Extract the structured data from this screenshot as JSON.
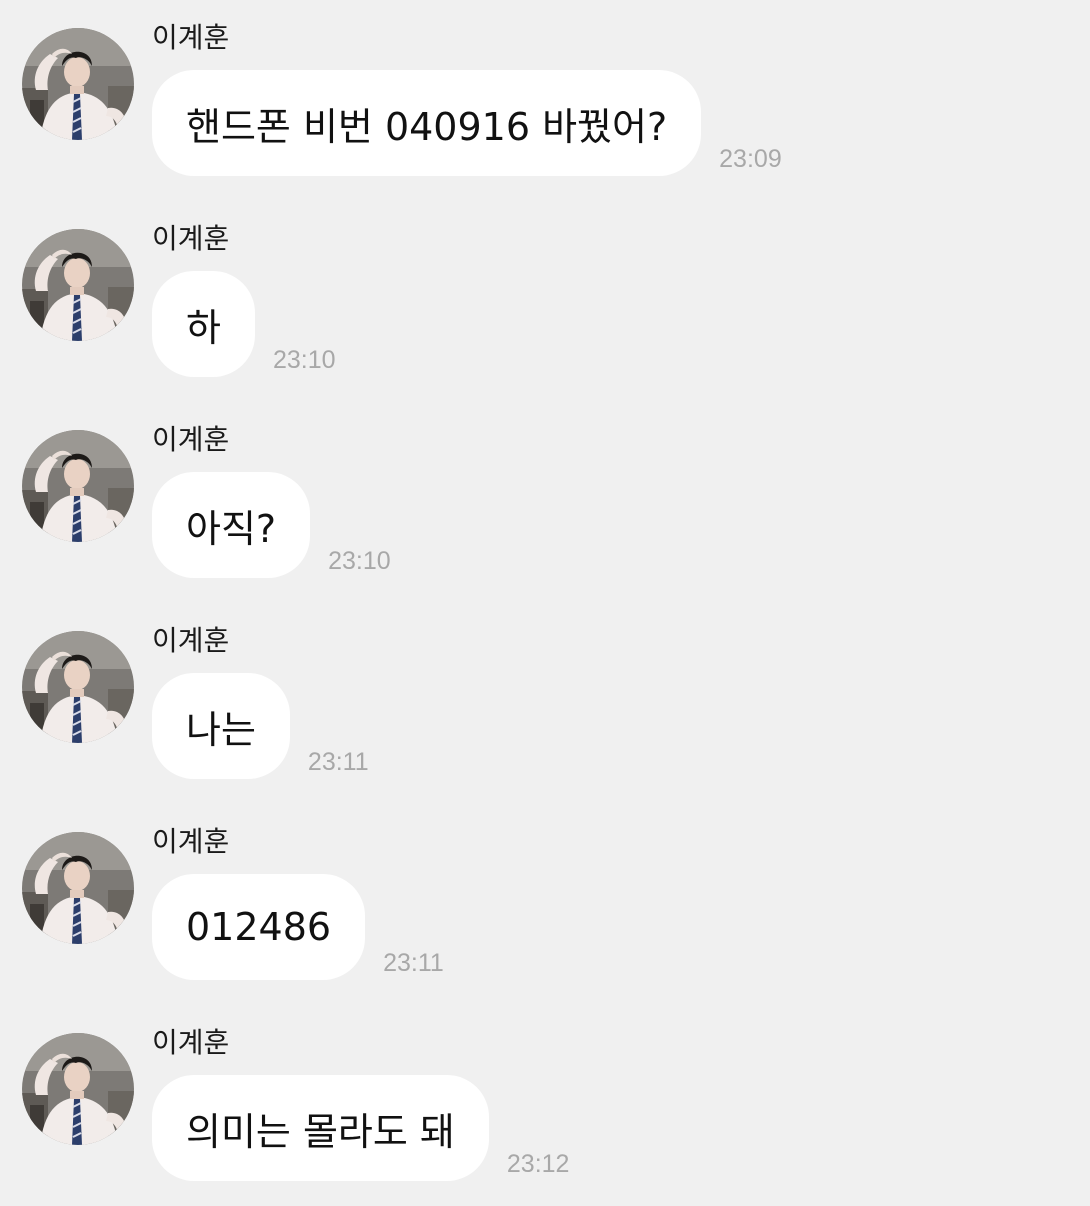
{
  "messages": [
    {
      "sender": "이계훈",
      "text": "핸드폰 비번 040916 바꿨어?",
      "time": "23:09"
    },
    {
      "sender": "이계훈",
      "text": "하",
      "time": "23:10"
    },
    {
      "sender": "이계훈",
      "text": "아직?",
      "time": "23:10"
    },
    {
      "sender": "이계훈",
      "text": "나는",
      "time": "23:11"
    },
    {
      "sender": "이계훈",
      "text": "012486",
      "time": "23:11"
    },
    {
      "sender": "이계훈",
      "text": "의미는 몰라도 돼",
      "time": "23:12"
    }
  ],
  "colors": {
    "background": "#f0f0f0",
    "bubble": "#ffffff",
    "text": "#111111",
    "timestamp": "#a8a8a8"
  },
  "icons": {
    "avatar": "profile-photo-avatar"
  }
}
